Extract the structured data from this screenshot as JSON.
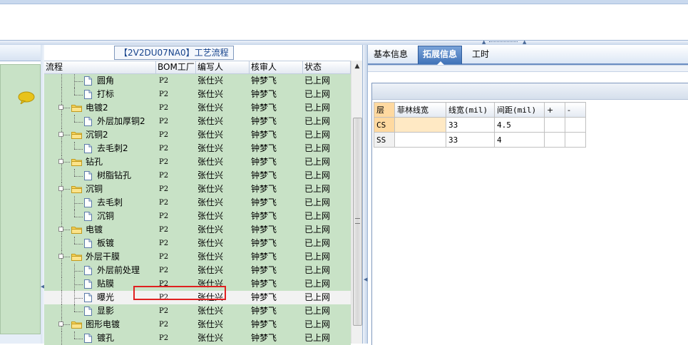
{
  "tree": {
    "title": "【2V2DU07NA0】工艺流程",
    "columns": [
      "流程",
      "BOM工厂",
      "编写人",
      "核审人",
      "状态"
    ],
    "rows": [
      {
        "label": "圆角",
        "level": 2,
        "type": "doc",
        "bom": "P2",
        "editor": "张仕兴",
        "reviewer": "钟梦飞",
        "status": "已上网"
      },
      {
        "label": "打标",
        "level": 2,
        "type": "doc",
        "bom": "P2",
        "editor": "张仕兴",
        "reviewer": "钟梦飞",
        "status": "已上网"
      },
      {
        "label": "电镀2",
        "level": 1,
        "type": "folder",
        "bom": "P2",
        "editor": "张仕兴",
        "reviewer": "钟梦飞",
        "status": "已上网"
      },
      {
        "label": "外层加厚铜2",
        "level": 2,
        "type": "doc",
        "bom": "P2",
        "editor": "张仕兴",
        "reviewer": "钟梦飞",
        "status": "已上网"
      },
      {
        "label": "沉铜2",
        "level": 1,
        "type": "folder",
        "bom": "P2",
        "editor": "张仕兴",
        "reviewer": "钟梦飞",
        "status": "已上网"
      },
      {
        "label": "去毛刺2",
        "level": 2,
        "type": "doc",
        "bom": "P2",
        "editor": "张仕兴",
        "reviewer": "钟梦飞",
        "status": "已上网"
      },
      {
        "label": "钻孔",
        "level": 1,
        "type": "folder",
        "bom": "P2",
        "editor": "张仕兴",
        "reviewer": "钟梦飞",
        "status": "已上网"
      },
      {
        "label": "树脂钻孔",
        "level": 2,
        "type": "doc",
        "bom": "P2",
        "editor": "张仕兴",
        "reviewer": "钟梦飞",
        "status": "已上网"
      },
      {
        "label": "沉铜",
        "level": 1,
        "type": "folder",
        "bom": "P2",
        "editor": "张仕兴",
        "reviewer": "钟梦飞",
        "status": "已上网"
      },
      {
        "label": "去毛刺",
        "level": 2,
        "type": "doc",
        "bom": "P2",
        "editor": "张仕兴",
        "reviewer": "钟梦飞",
        "status": "已上网"
      },
      {
        "label": "沉铜",
        "level": 2,
        "type": "doc",
        "bom": "P2",
        "editor": "张仕兴",
        "reviewer": "钟梦飞",
        "status": "已上网"
      },
      {
        "label": "电镀",
        "level": 1,
        "type": "folder",
        "bom": "P2",
        "editor": "张仕兴",
        "reviewer": "钟梦飞",
        "status": "已上网"
      },
      {
        "label": "板镀",
        "level": 2,
        "type": "doc",
        "bom": "P2",
        "editor": "张仕兴",
        "reviewer": "钟梦飞",
        "status": "已上网"
      },
      {
        "label": "外层干膜",
        "level": 1,
        "type": "folder",
        "bom": "P2",
        "editor": "张仕兴",
        "reviewer": "钟梦飞",
        "status": "已上网"
      },
      {
        "label": "外层前处理",
        "level": 2,
        "type": "doc",
        "bom": "P2",
        "editor": "张仕兴",
        "reviewer": "钟梦飞",
        "status": "已上网"
      },
      {
        "label": "贴膜",
        "level": 2,
        "type": "doc",
        "bom": "P2",
        "editor": "张仕兴",
        "reviewer": "钟梦飞",
        "status": "已上网"
      },
      {
        "label": "曝光",
        "level": 2,
        "type": "doc",
        "bom": "P2",
        "editor": "张仕兴",
        "reviewer": "钟梦飞",
        "status": "已上网",
        "selected": true
      },
      {
        "label": "显影",
        "level": 2,
        "type": "doc",
        "bom": "P2",
        "editor": "张仕兴",
        "reviewer": "钟梦飞",
        "status": "已上网"
      },
      {
        "label": "图形电镀",
        "level": 1,
        "type": "folder",
        "bom": "P2",
        "editor": "张仕兴",
        "reviewer": "钟梦飞",
        "status": "已上网"
      },
      {
        "label": "镀孔",
        "level": 2,
        "type": "doc",
        "bom": "P2",
        "editor": "张仕兴",
        "reviewer": "钟梦飞",
        "status": "已上网"
      }
    ]
  },
  "right": {
    "tabs": [
      {
        "label": "基本信息",
        "active": false
      },
      {
        "label": "拓展信息",
        "active": true
      },
      {
        "label": "工时",
        "active": false
      }
    ],
    "table": {
      "headers": [
        "层",
        "菲林线宽",
        "线宽(mil)",
        "间距(mil)",
        "+",
        "-"
      ],
      "rows": [
        [
          "CS",
          "",
          "33",
          "4.5",
          "",
          ""
        ],
        [
          "SS",
          "",
          "33",
          "4",
          "",
          ""
        ]
      ]
    }
  },
  "colors": {
    "tree_row_bg": "#c8e2c6",
    "selected_row_bg": "#f2f2f2",
    "highlight_box": "#e02020",
    "active_tab": "#3f72b8"
  }
}
